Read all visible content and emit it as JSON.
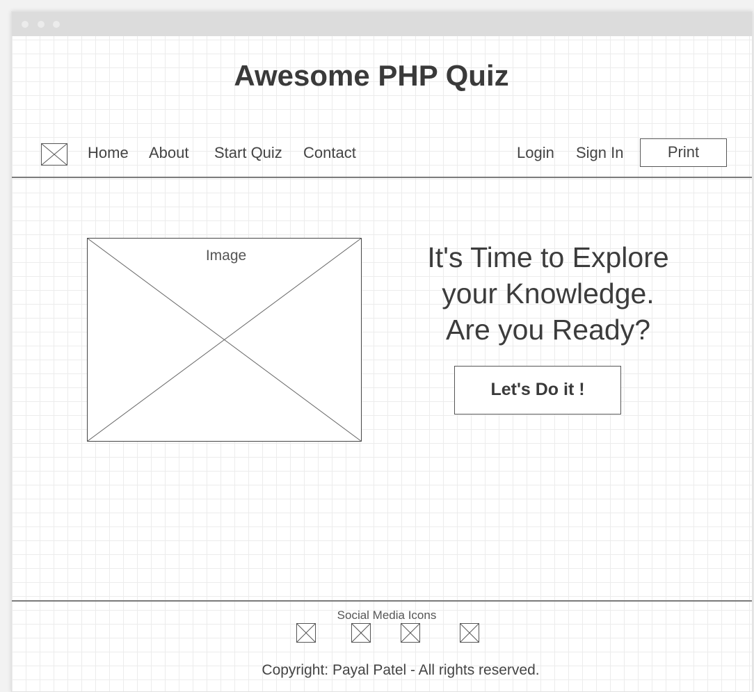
{
  "header": {
    "title": "Awesome PHP Quiz"
  },
  "logo": {
    "icon": "image-placeholder-icon"
  },
  "nav": {
    "left": [
      "Home",
      "About",
      "Start Quiz",
      "Contact"
    ],
    "right": [
      "Login",
      "Sign In"
    ],
    "print_label": "Print"
  },
  "hero": {
    "image_label": "Image",
    "headline": [
      "It's Time to Explore",
      "your Knowledge.",
      "Are you Ready?"
    ],
    "cta_label": "Let's Do it !"
  },
  "footer": {
    "social_label": "Social Media Icons",
    "social_icons": [
      "social-icon-1",
      "social-icon-2",
      "social-icon-3",
      "social-icon-4"
    ],
    "copyright": "Copyright: Payal Patel - All rights reserved."
  }
}
